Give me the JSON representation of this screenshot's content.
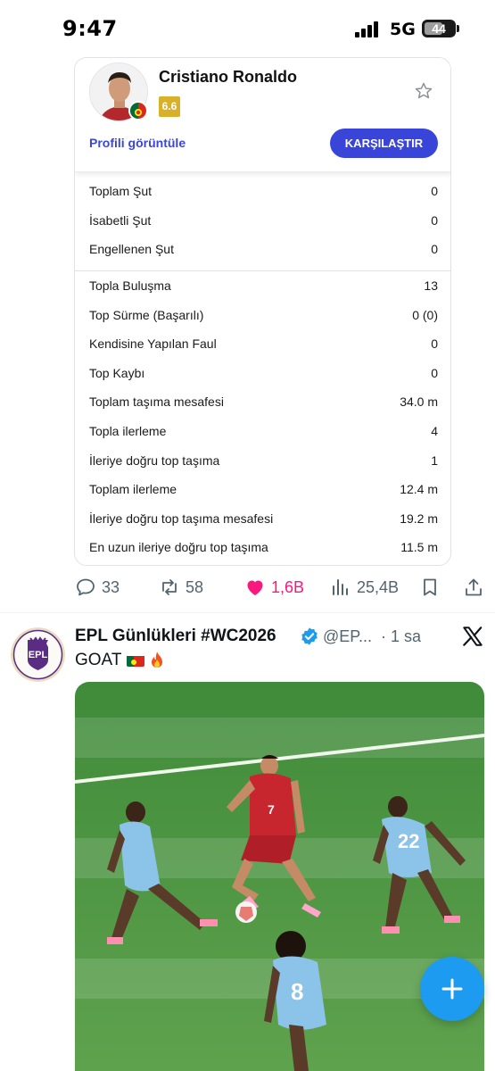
{
  "status_bar": {
    "time": "9:47",
    "network": "5G",
    "battery": "44"
  },
  "player_card": {
    "name": "Cristiano Ronaldo",
    "rating": "6.6",
    "profile_link": "Profili görüntüle",
    "compare_button": "KARŞILAŞTIR",
    "shooting_stats": [
      {
        "label": "Toplam Şut",
        "value": "0"
      },
      {
        "label": "İsabetli Şut",
        "value": "0"
      },
      {
        "label": "Engellenen Şut",
        "value": "0"
      }
    ],
    "possession_stats": [
      {
        "label": "Topla Buluşma",
        "value": "13"
      },
      {
        "label": "Top Sürme (Başarılı)",
        "value": "0 (0)"
      },
      {
        "label": "Kendisine Yapılan Faul",
        "value": "0"
      },
      {
        "label": "Top Kaybı",
        "value": "0"
      },
      {
        "label": "Toplam taşıma mesafesi",
        "value": "34.0 m"
      },
      {
        "label": "Topla ilerleme",
        "value": "4"
      },
      {
        "label": "İleriye doğru top taşıma",
        "value": "1"
      },
      {
        "label": "Toplam ilerleme",
        "value": "12.4 m"
      },
      {
        "label": "İleriye doğru top taşıma mesafesi",
        "value": "19.2 m"
      },
      {
        "label": "En uzun ileriye doğru top taşıma",
        "value": "11.5 m"
      }
    ]
  },
  "tweet_actions": {
    "replies": "33",
    "reposts": "58",
    "likes": "1,6B",
    "views": "25,4B"
  },
  "next_tweet": {
    "author_name": "EPL Günlükleri #WC2026",
    "handle": "@EP...",
    "time": "· 1 sa",
    "text": "GOAT",
    "avatar_text": "EPL",
    "jersey_numbers": [
      "7",
      "22",
      "8"
    ]
  },
  "colors": {
    "accent": "#3845d8",
    "like": "#f91880",
    "rating": "#d8b02a",
    "fab": "#1d9bf0"
  },
  "icons": [
    "star-icon",
    "reply-icon",
    "repost-icon",
    "heart-icon",
    "views-icon",
    "bookmark-icon",
    "share-icon",
    "verified-icon",
    "x-logo-icon",
    "plus-icon"
  ]
}
